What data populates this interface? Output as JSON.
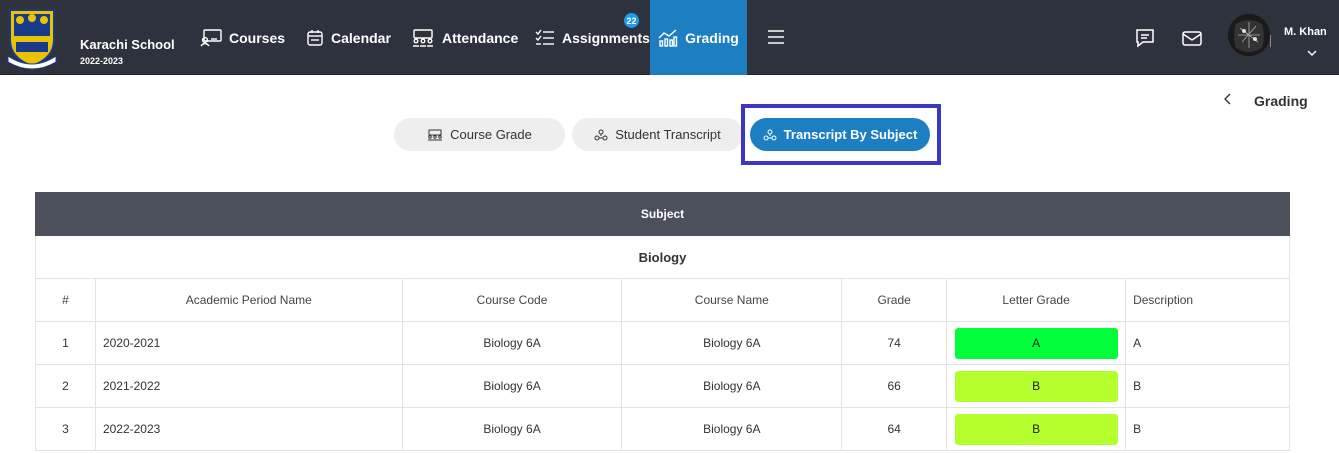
{
  "header": {
    "school_name": "Karachi School",
    "school_year": "2022-2023",
    "nav": [
      {
        "label": "Courses",
        "icon": "courses-icon"
      },
      {
        "label": "Calendar",
        "icon": "calendar-icon"
      },
      {
        "label": "Attendance",
        "icon": "attendance-icon"
      },
      {
        "label": "Assignments",
        "icon": "assignments-icon",
        "badge": "22"
      },
      {
        "label": "Grading",
        "icon": "grading-icon",
        "active": true
      }
    ],
    "user_name": "M. Khan"
  },
  "breadcrumb": {
    "title": "Grading"
  },
  "tabs": [
    {
      "label": "Course Grade",
      "icon": "course-grade-icon"
    },
    {
      "label": "Student Transcript",
      "icon": "transcript-icon"
    },
    {
      "label": "Transcript By Subject",
      "icon": "transcript-subject-icon",
      "active": true
    }
  ],
  "table": {
    "group_header": "Subject",
    "subject": "Biology",
    "columns": [
      "#",
      "Academic Period Name",
      "Course Code",
      "Course Name",
      "Grade",
      "Letter Grade",
      "Description"
    ],
    "rows": [
      {
        "num": "1",
        "period": "2020-2021",
        "code": "Biology 6A",
        "name": "Biology 6A",
        "grade": "74",
        "letter": "A",
        "letter_color": "#00ff3a",
        "description": "A"
      },
      {
        "num": "2",
        "period": "2021-2022",
        "code": "Biology 6A",
        "name": "Biology 6A",
        "grade": "66",
        "letter": "B",
        "letter_color": "#b5ff2e",
        "description": "B"
      },
      {
        "num": "3",
        "period": "2022-2023",
        "code": "Biology 6A",
        "name": "Biology 6A",
        "grade": "64",
        "letter": "B",
        "letter_color": "#b5ff2e",
        "description": "B"
      }
    ]
  },
  "colors": {
    "topbar": "#2d323d",
    "accent": "#1d7ec2",
    "highlight": "#3b36c4",
    "table_header": "#4b505b"
  }
}
